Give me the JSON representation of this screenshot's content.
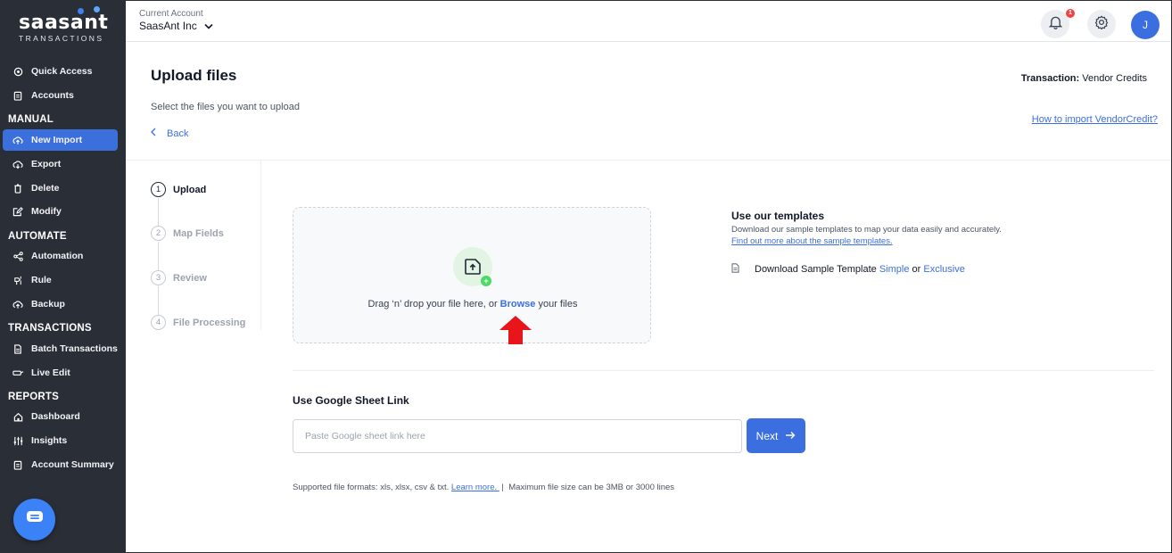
{
  "brand": {
    "logo_main": "saasant",
    "logo_sub": "TRANSACTIONS"
  },
  "sidebar": {
    "items": [
      {
        "label": "Quick Access",
        "icon": "target-icon"
      },
      {
        "label": "Accounts",
        "icon": "clipboard-icon"
      }
    ],
    "manual": {
      "heading": "MANUAL",
      "items": [
        {
          "label": "New Import",
          "icon": "cloud-upload-icon",
          "active": true
        },
        {
          "label": "Export",
          "icon": "cloud-download-icon"
        },
        {
          "label": "Delete",
          "icon": "trash-icon"
        },
        {
          "label": "Modify",
          "icon": "edit-icon"
        }
      ]
    },
    "automate": {
      "heading": "AUTOMATE",
      "items": [
        {
          "label": "Automation",
          "icon": "share-nodes-icon"
        },
        {
          "label": "Rule",
          "icon": "rule-icon"
        },
        {
          "label": "Backup",
          "icon": "cloud-backup-icon"
        }
      ]
    },
    "transactions": {
      "heading": "TRANSACTIONS",
      "items": [
        {
          "label": "Batch Transactions",
          "icon": "document-icon"
        },
        {
          "label": "Live Edit",
          "icon": "live-edit-icon"
        }
      ]
    },
    "reports": {
      "heading": "REPORTS",
      "items": [
        {
          "label": "Dashboard",
          "icon": "home-icon"
        },
        {
          "label": "Insights",
          "icon": "sliders-icon"
        },
        {
          "label": "Account Summary",
          "icon": "clipboard-icon"
        }
      ]
    }
  },
  "header": {
    "account_label": "Current Account",
    "account_name": "SaasAnt Inc",
    "notification_count": "1",
    "avatar_initial": "J"
  },
  "main": {
    "title": "Upload files",
    "subtitle": "Select the files you want to upload",
    "back_label": "Back",
    "transaction_label": "Transaction:",
    "transaction_value": "Vendor Credits",
    "howto_link": "How to import VendorCredit?",
    "steps": [
      {
        "num": "1",
        "label": "Upload",
        "active": true
      },
      {
        "num": "2",
        "label": "Map Fields"
      },
      {
        "num": "3",
        "label": "Review"
      },
      {
        "num": "4",
        "label": "File Processing"
      }
    ],
    "dropzone": {
      "text_before": "Drag ‘n’ drop your file here, or ",
      "browse": "Browse",
      "text_after": " your files"
    },
    "templates": {
      "title": "Use our templates",
      "description": "Download our sample templates to map your data easily and accurately.",
      "link": "Find out more about the sample templates.",
      "download_prefix": "Download Sample Template ",
      "simple": "Simple",
      "or": " or ",
      "exclusive": "Exclusive"
    },
    "google_sheet": {
      "title": "Use Google Sheet Link",
      "placeholder": "Paste Google sheet link here",
      "value": "",
      "next_label": "Next"
    },
    "formats": {
      "text": "Supported file formats: xls, xlsx, csv & txt. ",
      "learn_more": "Learn more. ",
      "separator": " |  ",
      "max_size": "Maximum file size can be 3MB or 3000 lines"
    }
  },
  "colors": {
    "sidebar_bg": "#2a2e36",
    "accent": "#3b6fe0",
    "active_item": "#3a6fdc",
    "badge": "#ef4444",
    "annotation_arrow": "#e8151b"
  }
}
